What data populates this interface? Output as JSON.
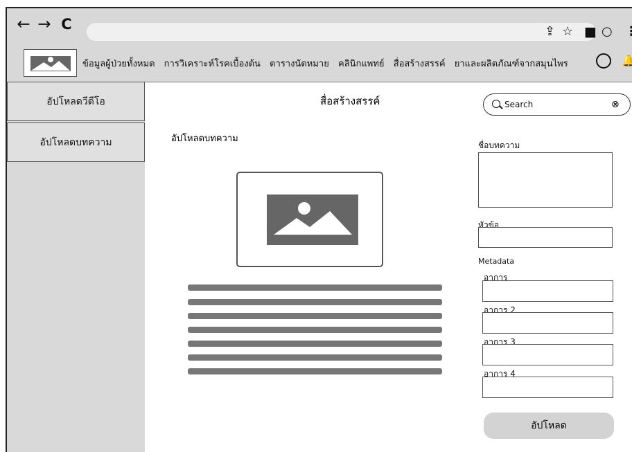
{
  "browser": {
    "back": "←",
    "forward": "→",
    "reload": "C",
    "url": "",
    "icons": [
      "share-icon",
      "star-icon",
      "sidebar-icon",
      "profile-icon",
      "menu-icon"
    ]
  },
  "nav": {
    "items": [
      "ข้อมูลผู้ป่วยทั้งหมด",
      "การวิเคราะห์โรคเบื้องต้น",
      "ตารางนัดหมาย",
      "คลินิกแพทย์",
      "สื่อสร้างสรรค์",
      "ยาและผลิตภัณฑ์จากสมุนไพร"
    ]
  },
  "sidebar": {
    "items": [
      "อัปโหลดวีดีโอ",
      "อัปโหลดบทความ"
    ]
  },
  "main": {
    "title": "สื่อสร้างสรรค์",
    "section": "อัปโหลดบทความ",
    "line_count": 7
  },
  "form": {
    "search_placeholder": "Search",
    "article_name": "ชื่อบทความ",
    "topic": "หัวข้อ",
    "metadata": "Metadata",
    "symptom_1": "อาการ",
    "symptom_2": "อาการ 2",
    "symptom_3": "อาการ 3",
    "symptom_4": "อาการ 4",
    "submit": "อัปโหลด"
  }
}
